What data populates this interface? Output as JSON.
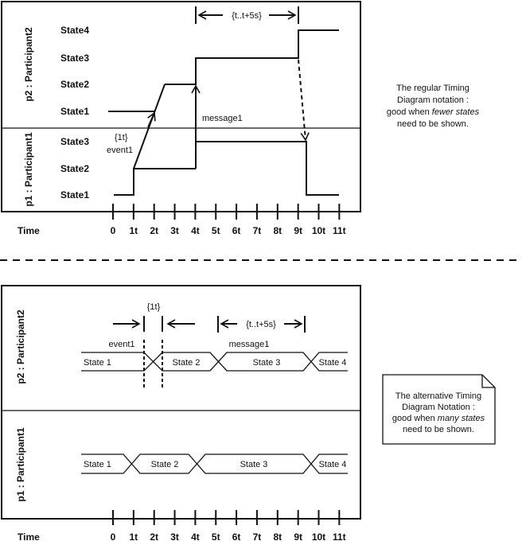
{
  "top_diagram": {
    "participants": [
      {
        "label": "p2 : Participant2",
        "states": [
          "State4",
          "State3",
          "State2",
          "State1"
        ]
      },
      {
        "label": "p1 : Participant1",
        "states": [
          "State3",
          "State2",
          "State1"
        ]
      }
    ],
    "time_label": "Time",
    "ticks": [
      "0",
      "1t",
      "2t",
      "3t",
      "4t",
      "5t",
      "6t",
      "7t",
      "8t",
      "9t",
      "10t",
      "11t"
    ],
    "constraint_duration": "{t..t+5s}",
    "constraint_event": "{1t}",
    "event_label": "event1",
    "message_label": "message1",
    "note": [
      "The regular Timing",
      "Diagram notation :",
      "good when ",
      "fewer states",
      "need to be shown."
    ]
  },
  "bottom_diagram": {
    "participants": [
      {
        "label": "p2 : Participant2",
        "states": [
          "State 1",
          "State 2",
          "State 3",
          "State 4"
        ]
      },
      {
        "label": "p1 : Participant1",
        "states": [
          "State 1",
          "State 2",
          "State 3",
          "State 4"
        ]
      }
    ],
    "time_label": "Time",
    "ticks": [
      "0",
      "1t",
      "2t",
      "3t",
      "4t",
      "5t",
      "6t",
      "7t",
      "8t",
      "9t",
      "10t",
      "11t"
    ],
    "constraint_event": "{1t}",
    "constraint_duration": "{t..t+5s}",
    "event_label": "event1",
    "message_label": "message1",
    "note": [
      "The alternative Timing",
      "Diagram Notation :",
      "good when ",
      "many states",
      "need to be shown."
    ]
  }
}
